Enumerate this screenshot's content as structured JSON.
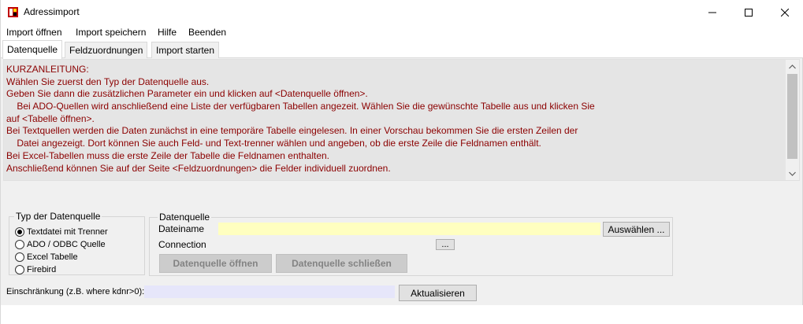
{
  "window": {
    "title": "Adressimport",
    "app_icon": "red-app-icon"
  },
  "menu": [
    "Import öffnen",
    "Import speichern",
    "Hilfe",
    "Beenden"
  ],
  "tabs": [
    {
      "label": "Datenquelle",
      "active": true
    },
    {
      "label": "Feldzuordnungen",
      "active": false
    },
    {
      "label": "Import starten",
      "active": false
    }
  ],
  "info": {
    "color": "#8b0000",
    "lines": [
      "KURZANLEITUNG:",
      "Wählen Sie zuerst den Typ der Datenquelle aus.",
      "Geben Sie dann die zusätzlichen Parameter ein und klicken auf <Datenquelle öffnen>.",
      "    Bei ADO-Quellen wird anschließend eine Liste der verfügbaren Tabellen angezeit. Wählen Sie die gewünschte Tabelle aus und klicken Sie",
      "auf <Tabelle öffnen>.",
      "Bei Textquellen werden die Daten zunächst in eine temporäre Tabelle eingelesen. In einer Vorschau bekommen Sie die ersten Zeilen der",
      "    Datei angezeigt. Dort können Sie auch Feld- und Text-trenner wählen und angeben, ob die erste Zeile die Feldnamen enthält.",
      "Bei Excel-Tabellen muss die erste Zeile der Tabelle die Feldnamen enthalten.",
      "Anschließend können Sie auf der Seite <Feldzuordnungen> die Felder individuell zuordnen."
    ]
  },
  "source_type": {
    "legend": "Typ der Datenquelle",
    "options": [
      {
        "label": "Textdatei mit Trenner",
        "checked": true
      },
      {
        "label": "ADO / ODBC Quelle",
        "checked": false
      },
      {
        "label": "Excel Tabelle",
        "checked": false
      },
      {
        "label": "Firebird",
        "checked": false
      }
    ]
  },
  "datasource": {
    "legend": "Datenquelle",
    "filename_label": "Dateiname",
    "filename_value": "",
    "select_button": "Auswählen ...",
    "connection_label": "Connection",
    "connection_button": "...",
    "open_button": "Datenquelle öffnen",
    "close_button": "Datenquelle schließen"
  },
  "filter": {
    "label": "Einschränkung (z.B. where kdnr>0):",
    "value": "",
    "refresh_button": "Aktualisieren"
  }
}
